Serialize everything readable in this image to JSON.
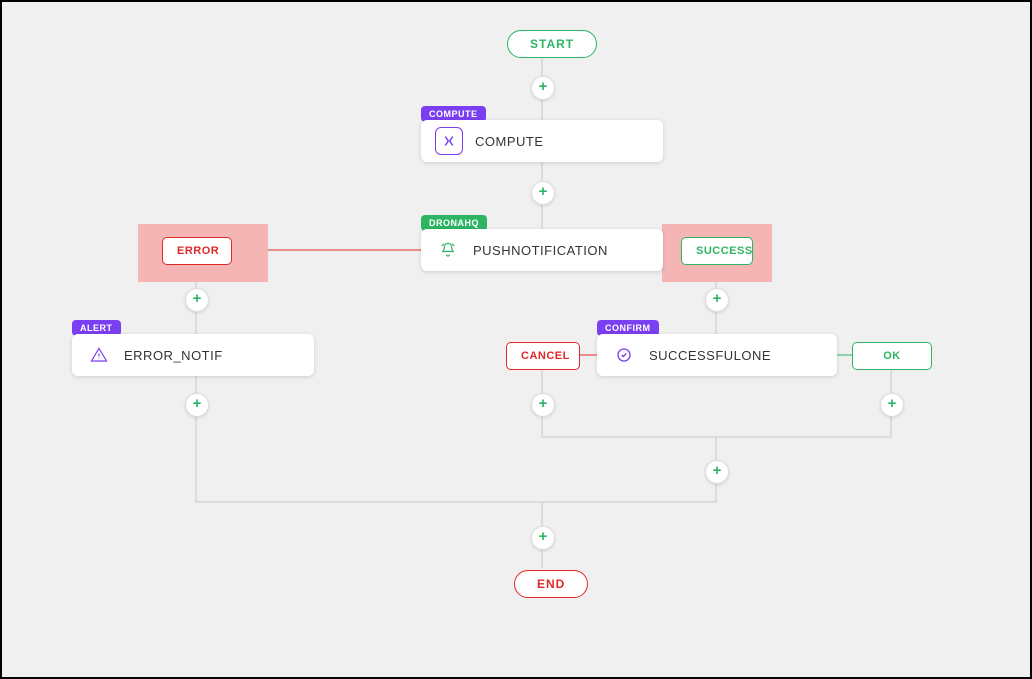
{
  "start": {
    "label": "START"
  },
  "end": {
    "label": "END"
  },
  "nodes": {
    "compute": {
      "tag": "COMPUTE",
      "label": "COMPUTE"
    },
    "push": {
      "tag": "DRONAHQ",
      "label": "PUSHNOTIFICATION"
    },
    "errnot": {
      "tag": "ALERT",
      "label": "ERROR_NOTIF"
    },
    "success": {
      "tag": "CONFIRM",
      "label": "SUCCESSFULONE"
    }
  },
  "branches": {
    "error": "ERROR",
    "success": "SUCCESS",
    "cancel": "CANCEL",
    "ok": "OK"
  },
  "colors": {
    "green": "#2db564",
    "red": "#e12828",
    "purple": "#7b3ff2",
    "highlight": "#f5b5b5"
  },
  "chart_data": {
    "type": "flow",
    "nodes": [
      {
        "id": "start",
        "label": "START",
        "kind": "start"
      },
      {
        "id": "compute",
        "label": "COMPUTE",
        "category": "COMPUTE",
        "kind": "action"
      },
      {
        "id": "push",
        "label": "PUSHNOTIFICATION",
        "category": "DRONAHQ",
        "kind": "action"
      },
      {
        "id": "errnot",
        "label": "ERROR_NOTIF",
        "category": "ALERT",
        "kind": "action"
      },
      {
        "id": "success",
        "label": "SUCCESSFULONE",
        "category": "CONFIRM",
        "kind": "action"
      },
      {
        "id": "end",
        "label": "END",
        "kind": "end"
      }
    ],
    "edges": [
      {
        "from": "start",
        "to": "compute"
      },
      {
        "from": "compute",
        "to": "push"
      },
      {
        "from": "push",
        "to": "errnot",
        "branch": "ERROR",
        "highlighted": true
      },
      {
        "from": "push",
        "to": "success",
        "branch": "SUCCESS",
        "highlighted": true
      },
      {
        "from": "errnot",
        "to": "end"
      },
      {
        "from": "success",
        "to": "end",
        "branch": "CANCEL"
      },
      {
        "from": "success",
        "to": "end",
        "branch": "OK"
      }
    ]
  }
}
